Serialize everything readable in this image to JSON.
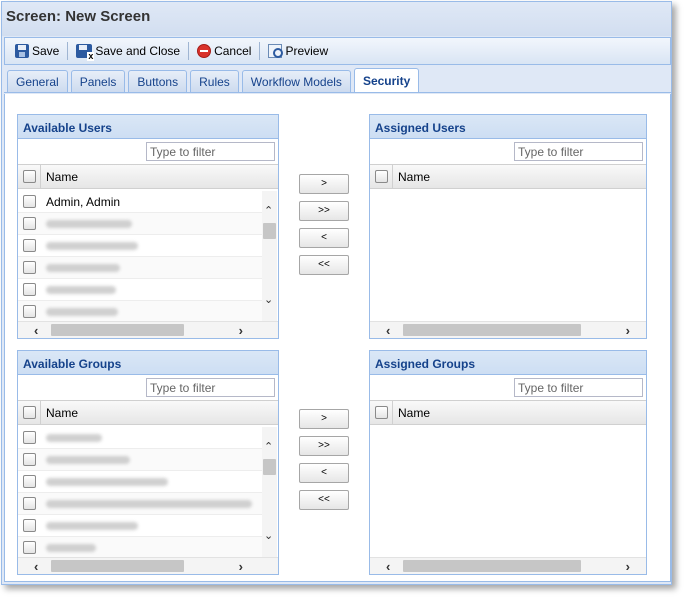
{
  "window": {
    "title": "Screen: New Screen"
  },
  "toolbar": {
    "save": {
      "label": "Save",
      "icon": "save-icon"
    },
    "save_close": {
      "label": "Save and Close",
      "icon": "save-close-icon"
    },
    "cancel": {
      "label": "Cancel",
      "icon": "cancel-icon"
    },
    "preview": {
      "label": "Preview",
      "icon": "preview-icon"
    }
  },
  "tabs": [
    {
      "label": "General"
    },
    {
      "label": "Panels"
    },
    {
      "label": "Buttons"
    },
    {
      "label": "Rules"
    },
    {
      "label": "Workflow Models"
    },
    {
      "label": "Security",
      "active": true
    }
  ],
  "available_users": {
    "title": "Available Users",
    "filter_placeholder": "Type to filter",
    "column": "Name",
    "rows": [
      {
        "name": "Admin, Admin",
        "blurred": false
      },
      {
        "name": "",
        "blurred": true
      },
      {
        "name": "",
        "blurred": true
      },
      {
        "name": "",
        "blurred": true
      },
      {
        "name": "",
        "blurred": true
      },
      {
        "name": "",
        "blurred": true
      }
    ]
  },
  "assigned_users": {
    "title": "Assigned Users",
    "filter_placeholder": "Type to filter",
    "column": "Name",
    "rows": []
  },
  "available_groups": {
    "title": "Available Groups",
    "filter_placeholder": "Type to filter",
    "column": "Name",
    "rows": [
      {
        "name": "",
        "blurred": true
      },
      {
        "name": "",
        "blurred": true
      },
      {
        "name": "",
        "blurred": true
      },
      {
        "name": "",
        "blurred": true
      },
      {
        "name": "",
        "blurred": true
      },
      {
        "name": "",
        "blurred": true
      }
    ]
  },
  "assigned_groups": {
    "title": "Assigned Groups",
    "filter_placeholder": "Type to filter",
    "column": "Name",
    "rows": []
  },
  "move_buttons": {
    "add": ">",
    "add_all": ">>",
    "remove": "<",
    "remove_all": "<<"
  },
  "colors": {
    "header_text": "#15428b",
    "border": "#99bbe8",
    "background": "#dfe8f6"
  }
}
